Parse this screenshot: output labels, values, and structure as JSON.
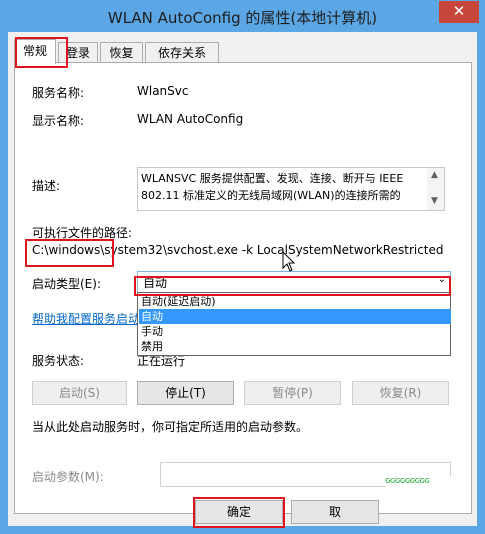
{
  "window": {
    "title": "WLAN AutoConfig 的属性(本地计算机)",
    "close_glyph": "✕"
  },
  "tabs": [
    {
      "label": "常规"
    },
    {
      "label": "登录"
    },
    {
      "label": "恢复"
    },
    {
      "label": "依存关系"
    }
  ],
  "general": {
    "service_name_label": "服务名称:",
    "service_name_value": "WlanSvc",
    "display_name_label": "显示名称:",
    "display_name_value": "WLAN AutoConfig",
    "description_label": "描述:",
    "description_value": "WLANSVC 服务提供配置、发现、连接、断开与 IEEE 802.11 标准定义的无线局域网(WLAN)的连接所需的",
    "exe_path_label": "可执行文件的路径:",
    "exe_path_value": "C:\\windows\\system32\\svchost.exe -k LocalSystemNetworkRestricted",
    "startup_type_label": "启动类型(E):",
    "startup_type_value": "自动",
    "startup_options": [
      "自动(延迟启动)",
      "自动",
      "手动",
      "禁用"
    ],
    "help_link": "帮助我配置服务启动",
    "status_label": "服务状态:",
    "status_value": "正在运行",
    "buttons": {
      "start": "启动(S)",
      "stop": "停止(T)",
      "pause": "暂停(P)",
      "resume": "恢复(R)"
    },
    "hint_text": "当从此处启动服务时，你可指定所适用的启动参数。",
    "start_params_label": "启动参数(M):",
    "start_params_value": ""
  },
  "footer": {
    "ok": "确定",
    "cancel": "取"
  },
  "colors": {
    "highlight": "#e0141e",
    "selection": "#3399ff",
    "title_bar": "#5ba6e4"
  }
}
